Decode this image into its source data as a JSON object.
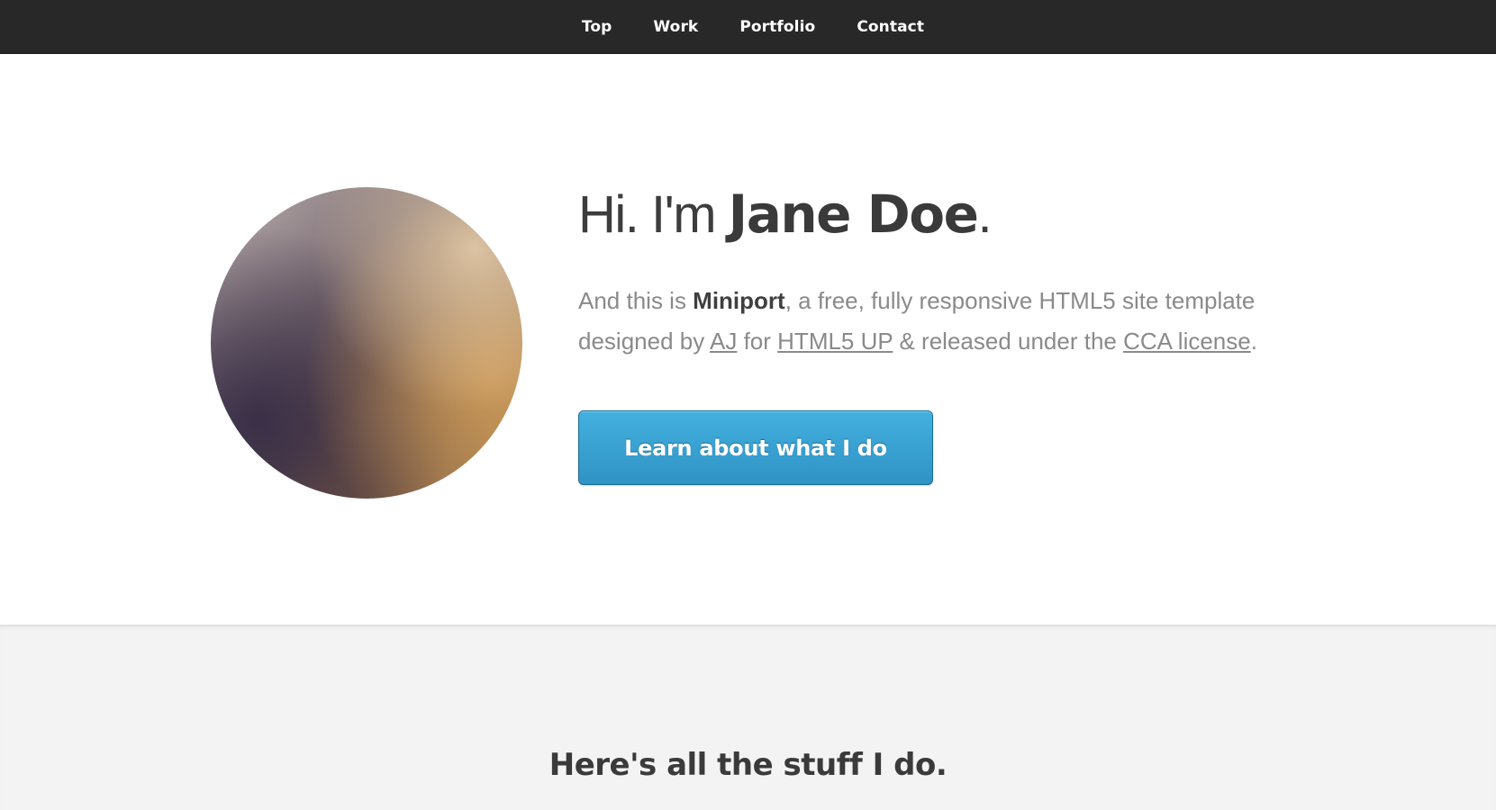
{
  "nav": {
    "items": [
      {
        "label": "Top"
      },
      {
        "label": "Work"
      },
      {
        "label": "Portfolio"
      },
      {
        "label": "Contact"
      }
    ]
  },
  "hero": {
    "greeting": "Hi. I'm ",
    "name": "Jane Doe",
    "period": ".",
    "text_intro": "And this is ",
    "template_name": "Miniport",
    "text_mid1": ", a free, fully responsive HTML5 site template designed by ",
    "author_link": "AJ",
    "text_mid2": " for ",
    "site_link": "HTML5 UP",
    "text_mid3": " & released under the ",
    "license_link": "CCA license",
    "text_end": ".",
    "cta_label": "Learn about what I do"
  },
  "work": {
    "heading": "Here's all the stuff I do."
  },
  "colors": {
    "nav_bg": "#282828",
    "cta_accent": "#3aa3d3",
    "section_bg": "#f3f3f3"
  }
}
